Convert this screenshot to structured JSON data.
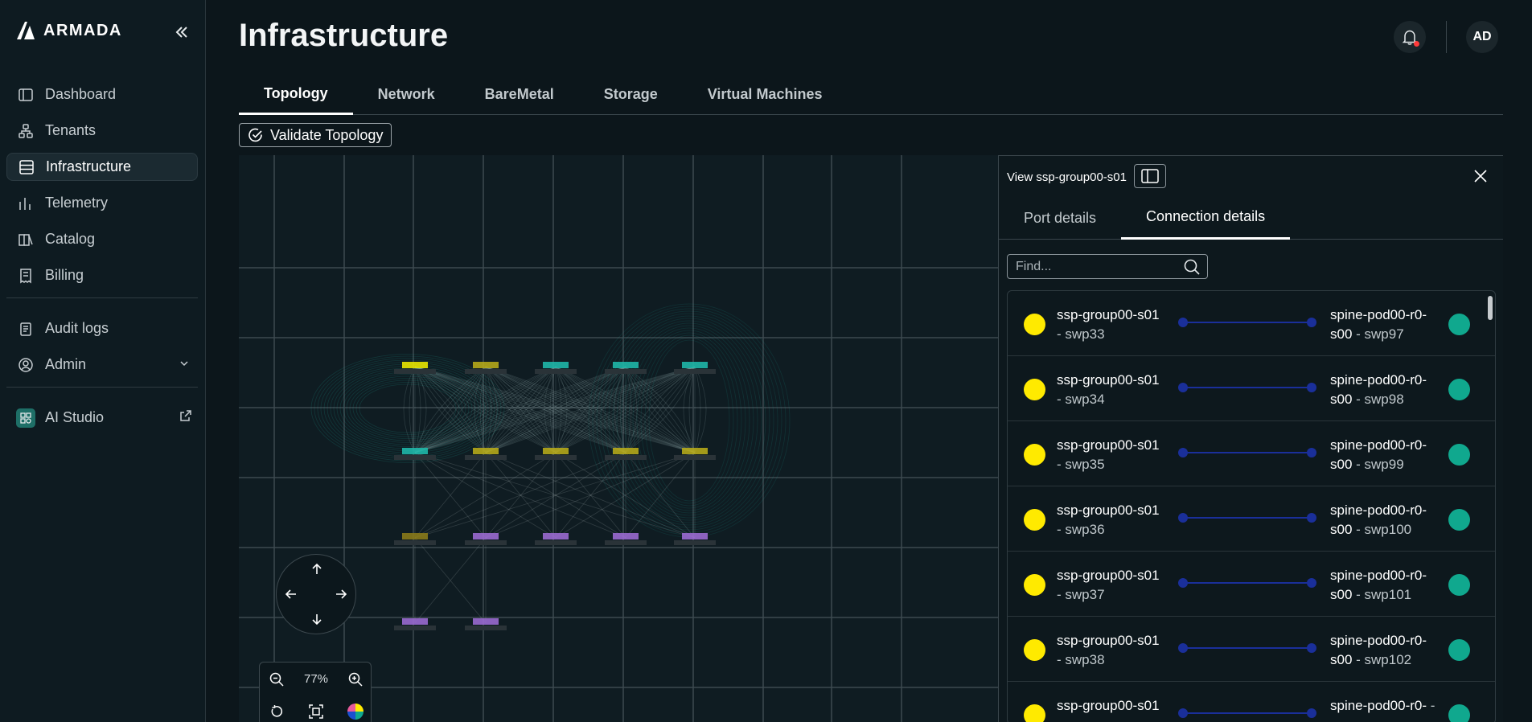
{
  "brand": {
    "name": "ARMADA"
  },
  "sidebar": {
    "items": [
      {
        "label": "Dashboard",
        "icon": "dashboard-icon"
      },
      {
        "label": "Tenants",
        "icon": "tenants-icon"
      },
      {
        "label": "Infrastructure",
        "icon": "infrastructure-icon",
        "active": true
      },
      {
        "label": "Telemetry",
        "icon": "telemetry-icon"
      },
      {
        "label": "Catalog",
        "icon": "catalog-icon"
      },
      {
        "label": "Billing",
        "icon": "billing-icon"
      }
    ],
    "secondary": [
      {
        "label": "Audit logs",
        "icon": "audit-logs-icon"
      },
      {
        "label": "Admin",
        "icon": "admin-icon"
      }
    ],
    "ai": {
      "label": "AI Studio",
      "icon": "ai-studio-icon"
    }
  },
  "header": {
    "title": "Infrastructure",
    "avatar_initials": "AD"
  },
  "tabs": [
    "Topology",
    "Network",
    "BareMetal",
    "Storage",
    "Virtual Machines"
  ],
  "toolbar": {
    "validate_label": "Validate Topology"
  },
  "canvas": {
    "zoom": "77%"
  },
  "panel": {
    "title": "View ssp-group00-s01",
    "tabs": [
      "Port details",
      "Connection details"
    ],
    "search_placeholder": "Find...",
    "colors": {
      "source": "#ffea00",
      "target": "#10a88e",
      "link": "#1a2f9a"
    },
    "connections": [
      {
        "src_device": "ssp-group00-s01",
        "src_port": "swp33",
        "dst_device": "spine-pod00-r0-s00",
        "dst_port": "swp97"
      },
      {
        "src_device": "ssp-group00-s01",
        "src_port": "swp34",
        "dst_device": "spine-pod00-r0-s00",
        "dst_port": "swp98"
      },
      {
        "src_device": "ssp-group00-s01",
        "src_port": "swp35",
        "dst_device": "spine-pod00-r0-s00",
        "dst_port": "swp99"
      },
      {
        "src_device": "ssp-group00-s01",
        "src_port": "swp36",
        "dst_device": "spine-pod00-r0-s00",
        "dst_port": "swp100"
      },
      {
        "src_device": "ssp-group00-s01",
        "src_port": "swp37",
        "dst_device": "spine-pod00-r0-s00",
        "dst_port": "swp101"
      },
      {
        "src_device": "ssp-group00-s01",
        "src_port": "swp38",
        "dst_device": "spine-pod00-r0-s00",
        "dst_port": "swp102"
      },
      {
        "src_device": "ssp-group00-s01",
        "src_port": "",
        "dst_device": "spine-pod00-r0-",
        "dst_port": ""
      }
    ]
  }
}
